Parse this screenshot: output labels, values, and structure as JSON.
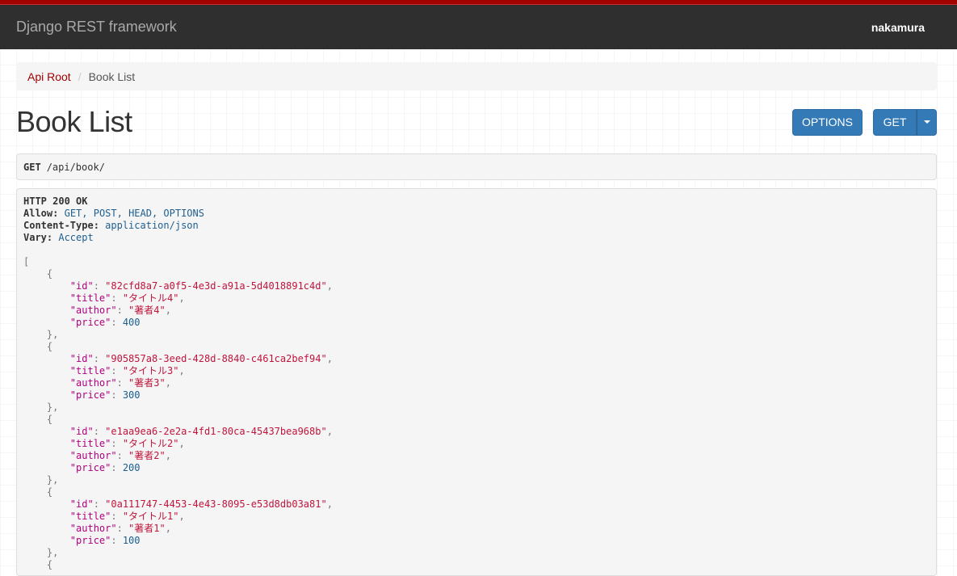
{
  "navbar": {
    "brand": "Django REST framework",
    "user": "nakamura"
  },
  "breadcrumb": {
    "root": "Api Root",
    "sep": "/",
    "current": "Book List"
  },
  "page": {
    "title": "Book List"
  },
  "buttons": {
    "options": "OPTIONS",
    "get": "GET"
  },
  "request": {
    "method": "GET",
    "path": "/api/book/"
  },
  "response": {
    "status": "HTTP 200 OK",
    "headers": [
      {
        "key": "Allow:",
        "value": "GET, POST, HEAD, OPTIONS"
      },
      {
        "key": "Content-Type:",
        "value": "application/json"
      },
      {
        "key": "Vary:",
        "value": "Accept"
      }
    ],
    "books": [
      {
        "id": "82cfd8a7-a0f5-4e3d-a91a-5d4018891c4d",
        "title": "タイトル4",
        "author": "著者4",
        "price": "400"
      },
      {
        "id": "905857a8-3eed-428d-8840-c461ca2bef94",
        "title": "タイトル3",
        "author": "著者3",
        "price": "300"
      },
      {
        "id": "e1aa9ea6-2e2a-4fd1-80ca-45437bea968b",
        "title": "タイトル2",
        "author": "著者2",
        "price": "200"
      },
      {
        "id": "0a111747-4453-4e43-8095-e53d8db03a81",
        "title": "タイトル1",
        "author": "著者1",
        "price": "100"
      }
    ]
  },
  "colors": {
    "accent": "#a30000",
    "button": "#337ab7",
    "navbar": "#2f2f2f"
  }
}
